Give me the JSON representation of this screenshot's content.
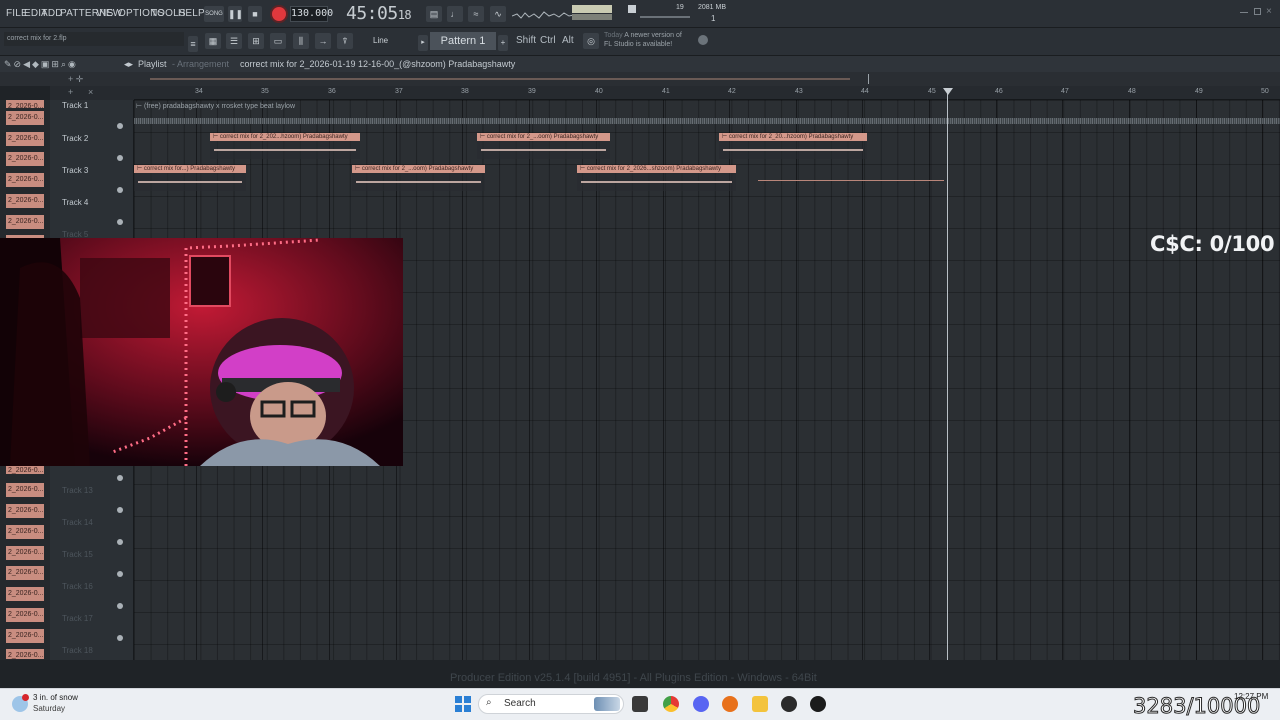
{
  "menu": [
    "FILE",
    "EDIT",
    "ADD",
    "PATTERNS",
    "VIEW",
    "OPTIONS",
    "TOOLS",
    "HELP"
  ],
  "transport": {
    "mode": "SONG",
    "bpm": "130.000",
    "time": "45:05",
    "time_ticks": "18",
    "cpu_value": "19",
    "ram": "2081 MB",
    "voices": "1"
  },
  "toolbar2": {
    "hint_file": "correct mix for 2.flp",
    "snap": "Line",
    "pattern": "Pattern 1",
    "keys": [
      "Shift",
      "Ctrl",
      "Alt"
    ],
    "news_day": "Today",
    "news_text_1": "A newer version of",
    "news_text_2": "FL Studio is available!"
  },
  "playlist": {
    "title": "Playlist",
    "sub": "Arrangement",
    "project": "correct mix for 2_2026-01-19 12-16-00_(@shzoom) Pradabagshawty",
    "bars": [
      "34",
      "35",
      "36",
      "37",
      "38",
      "39",
      "40",
      "41",
      "42",
      "43",
      "44",
      "45",
      "46",
      "47",
      "48",
      "49",
      "50"
    ],
    "tracks": [
      "Track 1",
      "Track 2",
      "Track 3",
      "Track 4",
      "Track 5",
      "Track 13",
      "Track 14",
      "Track 15",
      "Track 16",
      "Track 17",
      "Track 18"
    ],
    "track1_clip": "(free) pradabagshawty x rrosket type beat laylow",
    "clips": [
      "correct mix for 2_202...hzoom) Pradabagshawty",
      "correct mix for 2_...oom) Pradabagshawty",
      "correct mix for 2_20...hzoom) Pradabagshawty",
      "correct mix for...) Pradabagshawty",
      "correct mix for 2_...oom) Pradabagshawty",
      "correct mix for 2_2026...shzoom) Pradabagshawty"
    ],
    "strip_label": "2_2026-0...",
    "edition": "Producer Edition v25.1.4 [build 4951] - All Plugins Edition - Windows - 64Bit"
  },
  "overlay": {
    "score": "C$C: 0/100",
    "sub_count": "3283/10000"
  },
  "taskbar": {
    "weather_temp": "3 in. of snow",
    "weather_day": "Saturday",
    "search": "Search",
    "clock": "12:27 PM"
  },
  "colors": {
    "clip_header": "#d4988a",
    "record": "#e0383d",
    "webcam_red": "#8a1427"
  }
}
